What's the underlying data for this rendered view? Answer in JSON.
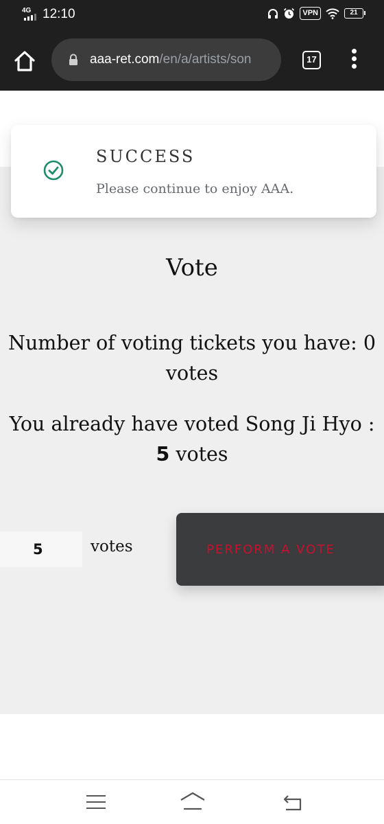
{
  "status_bar": {
    "network": "4G",
    "time": "12:10",
    "vpn": "VPN",
    "battery": "21",
    "icons": [
      "signal-icon",
      "headphones-icon",
      "alarm-icon",
      "wifi-icon",
      "battery-icon"
    ]
  },
  "browser": {
    "url_host": "aaa-ret.com",
    "url_path": "/en/a/artists/son",
    "tab_count": "17",
    "icons": [
      "home-icon",
      "lock-icon",
      "tabs-icon",
      "more-vert-icon"
    ]
  },
  "toast": {
    "title": "SUCCESS",
    "message": "Please continue to enjoy AAA.",
    "icon": "check-circle-icon",
    "accent": "#1e8c6a"
  },
  "vote": {
    "title": "Vote",
    "tickets_line1": "Number of voting tickets you have: 0",
    "tickets_line2": "votes",
    "voted_line1": "You already have voted Song Ji Hyo :",
    "voted_count": "5",
    "voted_unit": "votes",
    "input_value": "5",
    "input_unit": "votes",
    "button_label": "PERFORM A VOTE",
    "button_color": "#3b3c3e",
    "button_text_color": "#c8102e"
  },
  "nav_bar": {
    "icons": [
      "menu-icon",
      "home-icon",
      "back-icon"
    ]
  }
}
